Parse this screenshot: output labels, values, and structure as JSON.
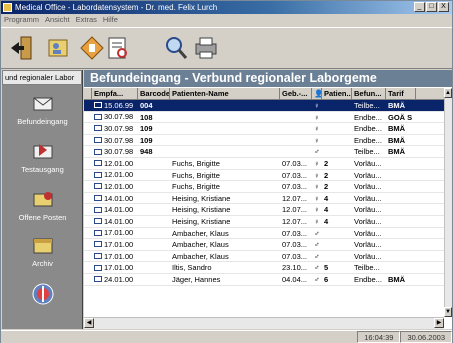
{
  "window": {
    "title": "Medical Office - Labordatensystem - Dr. med. Felix Lurch",
    "min": "_",
    "max": "□",
    "close": "X"
  },
  "menu": [
    "Programm",
    "Ansicht",
    "Extras",
    "Hilfe"
  ],
  "sidebar": {
    "tab_label": "und regionaler Labor",
    "items": [
      {
        "label": "Befundeingang",
        "icon": "inbox-icon"
      },
      {
        "label": "Testausgang",
        "icon": "outbox-icon"
      },
      {
        "label": "Offene Posten",
        "icon": "open-items-icon"
      },
      {
        "label": "Archiv",
        "icon": "archive-icon"
      }
    ]
  },
  "main": {
    "title": "Befundeingang - Verbund regionaler Laborgeme",
    "columns": [
      "",
      "Empfa...",
      "Barcode",
      "Patienten-Name",
      "Geb.-...",
      "",
      "Patien...",
      "Befun...",
      "Tarif"
    ],
    "rows": [
      {
        "date": "15.06.99",
        "barcode": "004",
        "name": "",
        "dob": "",
        "gender": "♀",
        "pat": "",
        "befund": "Teilbe...",
        "tarif": "BMÄ",
        "selected": true
      },
      {
        "date": "30.07.98",
        "barcode": "108",
        "name": "",
        "dob": "",
        "gender": "♀",
        "pat": "",
        "befund": "Endbe...",
        "tarif": "GOÄ S"
      },
      {
        "date": "30.07.98",
        "barcode": "109",
        "name": "",
        "dob": "",
        "gender": "♀",
        "pat": "",
        "befund": "Endbe...",
        "tarif": "BMÄ"
      },
      {
        "date": "30.07.98",
        "barcode": "109",
        "name": "",
        "dob": "",
        "gender": "♀",
        "pat": "",
        "befund": "Endbe...",
        "tarif": "BMÄ"
      },
      {
        "date": "30.07.98",
        "barcode": "948",
        "name": "",
        "dob": "",
        "gender": "♂",
        "pat": "",
        "befund": "Teilbe...",
        "tarif": "BMÄ"
      },
      {
        "date": "12.01.00",
        "barcode": "",
        "name": "Fuchs, Brigitte",
        "dob": "07.03...",
        "gender": "♀",
        "pat": "2",
        "befund": "Vorläu...",
        "tarif": ""
      },
      {
        "date": "12.01.00",
        "barcode": "",
        "name": "Fuchs, Brigitte",
        "dob": "07.03...",
        "gender": "♀",
        "pat": "2",
        "befund": "Vorläu...",
        "tarif": ""
      },
      {
        "date": "12.01.00",
        "barcode": "",
        "name": "Fuchs, Brigitte",
        "dob": "07.03...",
        "gender": "♀",
        "pat": "2",
        "befund": "Vorläu...",
        "tarif": ""
      },
      {
        "date": "14.01.00",
        "barcode": "",
        "name": "Heising, Kristiane",
        "dob": "12.07...",
        "gender": "♀",
        "pat": "4",
        "befund": "Vorläu...",
        "tarif": ""
      },
      {
        "date": "14.01.00",
        "barcode": "",
        "name": "Heising, Kristiane",
        "dob": "12.07...",
        "gender": "♀",
        "pat": "4",
        "befund": "Vorläu...",
        "tarif": ""
      },
      {
        "date": "14.01.00",
        "barcode": "",
        "name": "Heising, Kristiane",
        "dob": "12.07...",
        "gender": "♀",
        "pat": "4",
        "befund": "Vorläu...",
        "tarif": ""
      },
      {
        "date": "17.01.00",
        "barcode": "",
        "name": "Ambacher, Klaus",
        "dob": "07.03...",
        "gender": "♂",
        "pat": "",
        "befund": "Vorläu...",
        "tarif": ""
      },
      {
        "date": "17.01.00",
        "barcode": "",
        "name": "Ambacher, Klaus",
        "dob": "07.03...",
        "gender": "♂",
        "pat": "",
        "befund": "Vorläu...",
        "tarif": ""
      },
      {
        "date": "17.01.00",
        "barcode": "",
        "name": "Ambacher, Klaus",
        "dob": "07.03...",
        "gender": "♂",
        "pat": "",
        "befund": "Vorläu...",
        "tarif": ""
      },
      {
        "date": "17.01.00",
        "barcode": "",
        "name": "Iltis, Sandro",
        "dob": "23.10...",
        "gender": "♂",
        "pat": "5",
        "befund": "Teilbe...",
        "tarif": ""
      },
      {
        "date": "24.01.00",
        "barcode": "",
        "name": "Jäger, Hannes",
        "dob": "04.04...",
        "gender": "♂",
        "pat": "6",
        "befund": "Endbe...",
        "tarif": "BMÄ"
      }
    ]
  },
  "status": {
    "time": "16:04:39",
    "date": "30.06.2003"
  },
  "colors": {
    "title_bar": "#0a246a",
    "header_band": "#6b7f95",
    "sidebar": "#8a8a8a"
  }
}
